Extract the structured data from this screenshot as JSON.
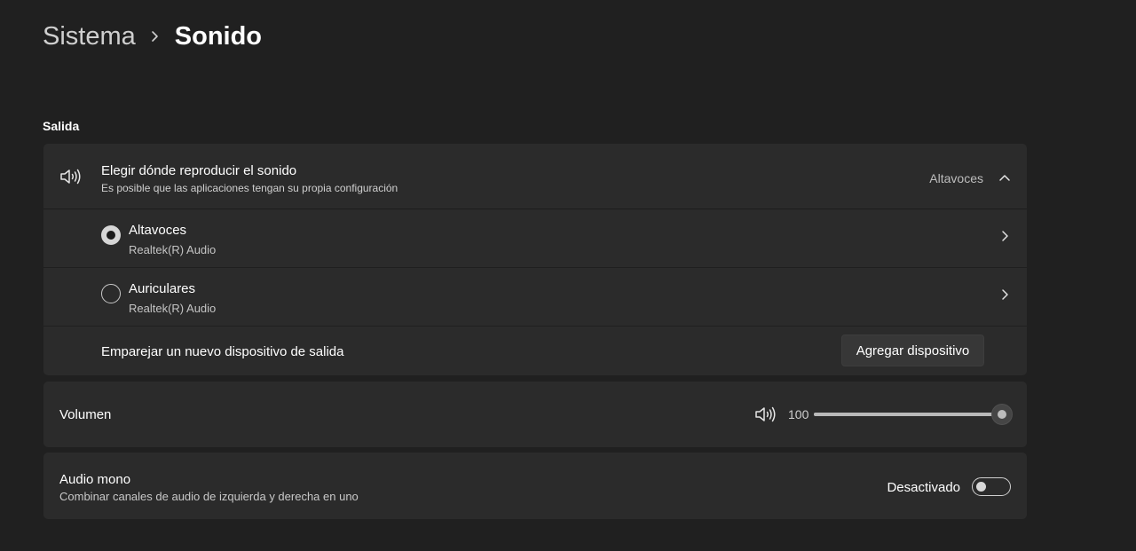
{
  "breadcrumb": {
    "parent": "Sistema",
    "current": "Sonido"
  },
  "output_section": {
    "title": "Salida",
    "choose_output": {
      "title": "Elegir dónde reproducir el sonido",
      "subtitle": "Es posible que las aplicaciones tengan su propia configuración",
      "selected_value": "Altavoces",
      "expanded": true
    },
    "devices": [
      {
        "name": "Altavoces",
        "driver": "Realtek(R) Audio",
        "selected": true
      },
      {
        "name": "Auriculares",
        "driver": "Realtek(R) Audio",
        "selected": false
      }
    ],
    "pair": {
      "label": "Emparejar un nuevo dispositivo de salida",
      "button": "Agregar dispositivo"
    }
  },
  "volume": {
    "label": "Volumen",
    "value": "100",
    "level_percent": 100
  },
  "mono": {
    "title": "Audio mono",
    "subtitle": "Combinar canales de audio de izquierda y derecha en uno",
    "state_label": "Desactivado",
    "enabled": false
  },
  "colors": {
    "background": "#202020",
    "card": "#2b2b2b",
    "text_primary": "#ffffff",
    "text_secondary": "#cfcfcf"
  },
  "icons": {
    "breadcrumb_separator": "chevron-right-icon",
    "output": "speaker-icon",
    "expand": "chevron-up-icon",
    "device_nav": "chevron-right-icon",
    "volume": "speaker-icon"
  }
}
